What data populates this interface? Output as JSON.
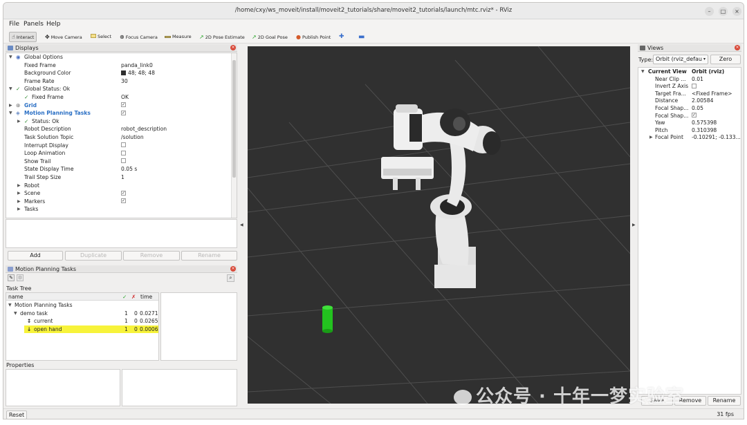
{
  "window": {
    "title": "/home/cxy/ws_moveit/install/moveit2_tutorials/share/moveit2_tutorials/launch/mtc.rviz* - RViz",
    "controls": [
      "–",
      "□",
      "×"
    ]
  },
  "menu": [
    "File",
    "Panels",
    "Help"
  ],
  "toolbar": {
    "tools": [
      {
        "label": "Interact",
        "icon": "hand-icon"
      },
      {
        "label": "Move Camera",
        "icon": "move-camera-icon"
      },
      {
        "label": "Select",
        "icon": "select-icon"
      },
      {
        "label": "Focus Camera",
        "icon": "focus-camera-icon"
      },
      {
        "label": "Measure",
        "icon": "measure-icon"
      },
      {
        "label": "2D Pose Estimate",
        "icon": "green-arrow-icon"
      },
      {
        "label": "2D Goal Pose",
        "icon": "green-arrow-icon"
      },
      {
        "label": "Publish Point",
        "icon": "pin-icon"
      }
    ],
    "extra_icons": [
      "plus-move-icon",
      "minus-icon"
    ]
  },
  "displays": {
    "title": "Displays",
    "rows": [
      {
        "label": "Global Options",
        "value": ""
      },
      {
        "label": "Fixed Frame",
        "value": "panda_link0"
      },
      {
        "label": "Background Color",
        "value": "48; 48; 48"
      },
      {
        "label": "Frame Rate",
        "value": "30"
      },
      {
        "label": "Global Status: Ok",
        "value": ""
      },
      {
        "label": "Fixed Frame",
        "value": "OK"
      },
      {
        "label": "Grid",
        "value": ""
      },
      {
        "label": "Motion Planning Tasks",
        "value": ""
      },
      {
        "label": "Status: Ok",
        "value": ""
      },
      {
        "label": "Robot Description",
        "value": "robot_description"
      },
      {
        "label": "Task Solution Topic",
        "value": "/solution"
      },
      {
        "label": "Interrupt Display",
        "value": ""
      },
      {
        "label": "Loop Animation",
        "value": ""
      },
      {
        "label": "Show Trail",
        "value": ""
      },
      {
        "label": "State Display Time",
        "value": "0.05 s"
      },
      {
        "label": "Trail Step Size",
        "value": "1"
      },
      {
        "label": "Robot",
        "value": ""
      },
      {
        "label": "Scene",
        "value": ""
      },
      {
        "label": "Markers",
        "value": ""
      },
      {
        "label": "Tasks",
        "value": ""
      }
    ],
    "buttons": {
      "add": "Add",
      "duplicate": "Duplicate",
      "remove": "Remove",
      "rename": "Rename"
    }
  },
  "mpt": {
    "title": "Motion Planning Tasks",
    "task_tree_label": "Task Tree",
    "columns": {
      "name": "name",
      "ok": "✓",
      "fail": "✗",
      "time": "time"
    },
    "rows": [
      {
        "name": "Motion Planning Tasks",
        "ok": "",
        "fail": "",
        "time": ""
      },
      {
        "name": "demo task",
        "ok": "1",
        "fail": "0",
        "time": "0.0271"
      },
      {
        "name": "current",
        "ok": "1",
        "fail": "0",
        "time": "0.0265"
      },
      {
        "name": "open hand",
        "ok": "1",
        "fail": "0",
        "time": "0.0006"
      }
    ],
    "properties_label": "Properties"
  },
  "views": {
    "title": "Views",
    "type_label": "Type:",
    "type_value": "Orbit (rviz_defau",
    "zero": "Zero",
    "current_view": "Current View",
    "current_type": "Orbit (rviz)",
    "props": [
      {
        "label": "Near Clip ...",
        "value": "0.01"
      },
      {
        "label": "Invert Z Axis",
        "value": ""
      },
      {
        "label": "Target Fra...",
        "value": "<Fixed Frame>"
      },
      {
        "label": "Distance",
        "value": "2.00584"
      },
      {
        "label": "Focal Shap...",
        "value": "0.05"
      },
      {
        "label": "Focal Shap...",
        "value": "✓"
      },
      {
        "label": "Yaw",
        "value": "0.575398"
      },
      {
        "label": "Pitch",
        "value": "0.310398"
      },
      {
        "label": "Focal Point",
        "value": "-0.10291; -0.133..."
      }
    ],
    "buttons": {
      "save": "Save",
      "remove": "Remove",
      "rename": "Rename"
    }
  },
  "status": {
    "reset": "Reset",
    "fps": "31 fps"
  },
  "watermark": "公众号 · 十年一梦实验室"
}
